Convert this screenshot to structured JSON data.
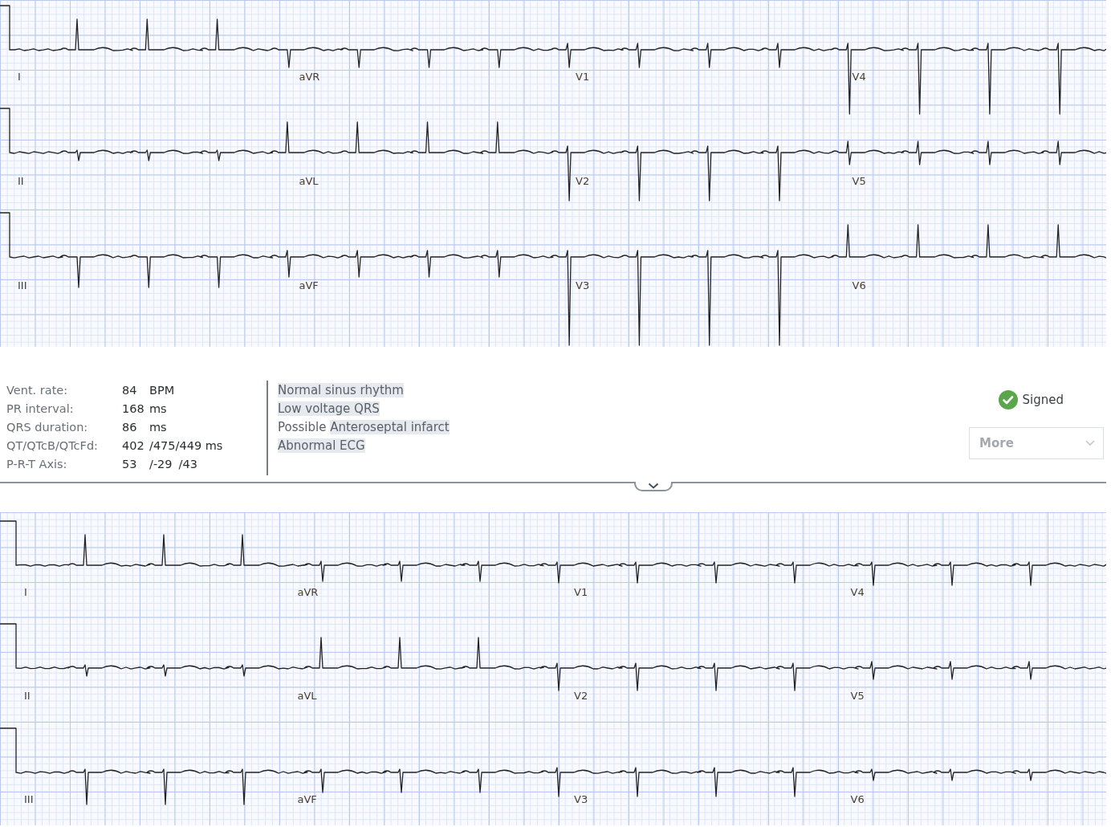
{
  "top_ecg": {
    "leads": [
      "I",
      "aVR",
      "V1",
      "V4",
      "II",
      "aVL",
      "V2",
      "V5",
      "III",
      "aVF",
      "V3",
      "V6"
    ]
  },
  "measurements": [
    {
      "label": "Vent. rate:",
      "values": [
        "84",
        "BPM"
      ]
    },
    {
      "label": "PR interval:",
      "values": [
        "168",
        "ms"
      ]
    },
    {
      "label": "QRS duration:",
      "values": [
        "86",
        "ms"
      ]
    },
    {
      "label": "QT/QTcB/QTcFd:",
      "values": [
        "402",
        "/475/449 ms"
      ]
    },
    {
      "label": "P-R-T Axis:",
      "values": [
        "53",
        "/-29",
        "/43"
      ]
    }
  ],
  "interpretation": [
    {
      "parts": [
        {
          "text": "Normal sinus rhythm",
          "highlighted": true
        }
      ]
    },
    {
      "parts": [
        {
          "text": "Low voltage QRS",
          "highlighted": true
        }
      ]
    },
    {
      "parts": [
        {
          "text": "Possible ",
          "highlighted": false
        },
        {
          "text": "Anteroseptal infarct",
          "highlighted": true
        }
      ]
    },
    {
      "parts": [
        {
          "text": "Abnormal ECG",
          "highlighted": true
        }
      ]
    }
  ],
  "status": {
    "label": "Signed",
    "signed": true
  },
  "more_button": {
    "label": "More",
    "disabled": true
  },
  "bottom_ecg": {
    "leads": [
      "I",
      "aVR",
      "V1",
      "V4",
      "II",
      "aVL",
      "V2",
      "V5",
      "III",
      "aVF",
      "V3",
      "V6"
    ]
  }
}
